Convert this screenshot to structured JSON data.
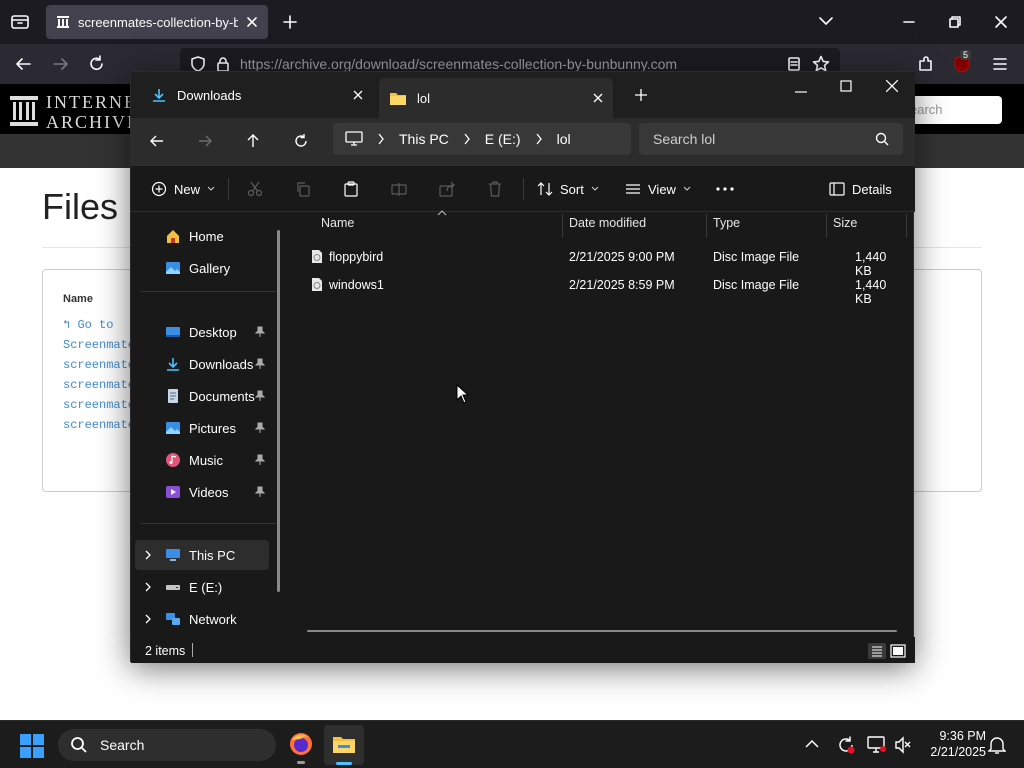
{
  "browser": {
    "tab_title": "screenmates-collection-by-bunbunny",
    "url": "https://archive.org/download/screenmates-collection-by-bunbunny.com",
    "notification_badge": "5",
    "page_search_placeholder": "earch"
  },
  "archive_page": {
    "logo_line1": "INTERNE",
    "logo_line2": "ARCHIVE",
    "title": "Files",
    "column_name": "Name",
    "links": [
      "Go to",
      "Screenmate",
      "screenmate",
      "screenmate",
      "screenmate",
      "screenmate"
    ]
  },
  "explorer": {
    "tabs": [
      {
        "label": "Downloads"
      },
      {
        "label": "lol"
      }
    ],
    "breadcrumb": [
      "This PC",
      "E (E:)",
      "lol"
    ],
    "search_placeholder": "Search lol",
    "commands": {
      "new": "New",
      "sort": "Sort",
      "view": "View",
      "details": "Details"
    },
    "nav": {
      "home": "Home",
      "gallery": "Gallery",
      "pinned": [
        "Desktop",
        "Downloads",
        "Documents",
        "Pictures",
        "Music",
        "Videos"
      ],
      "this_pc": "This PC",
      "drive": "E (E:)",
      "network": "Network"
    },
    "columns": {
      "name": "Name",
      "date": "Date modified",
      "type": "Type",
      "size": "Size"
    },
    "files": [
      {
        "name": "floppybird",
        "date": "2/21/2025 9:00 PM",
        "type": "Disc Image File",
        "size": "1,440 KB"
      },
      {
        "name": "windows1",
        "date": "2/21/2025 8:59 PM",
        "type": "Disc Image File",
        "size": "1,440 KB"
      }
    ],
    "status": "2 items"
  },
  "taskbar": {
    "search_label": "Search",
    "time": "9:36 PM",
    "date": "2/21/2025"
  }
}
